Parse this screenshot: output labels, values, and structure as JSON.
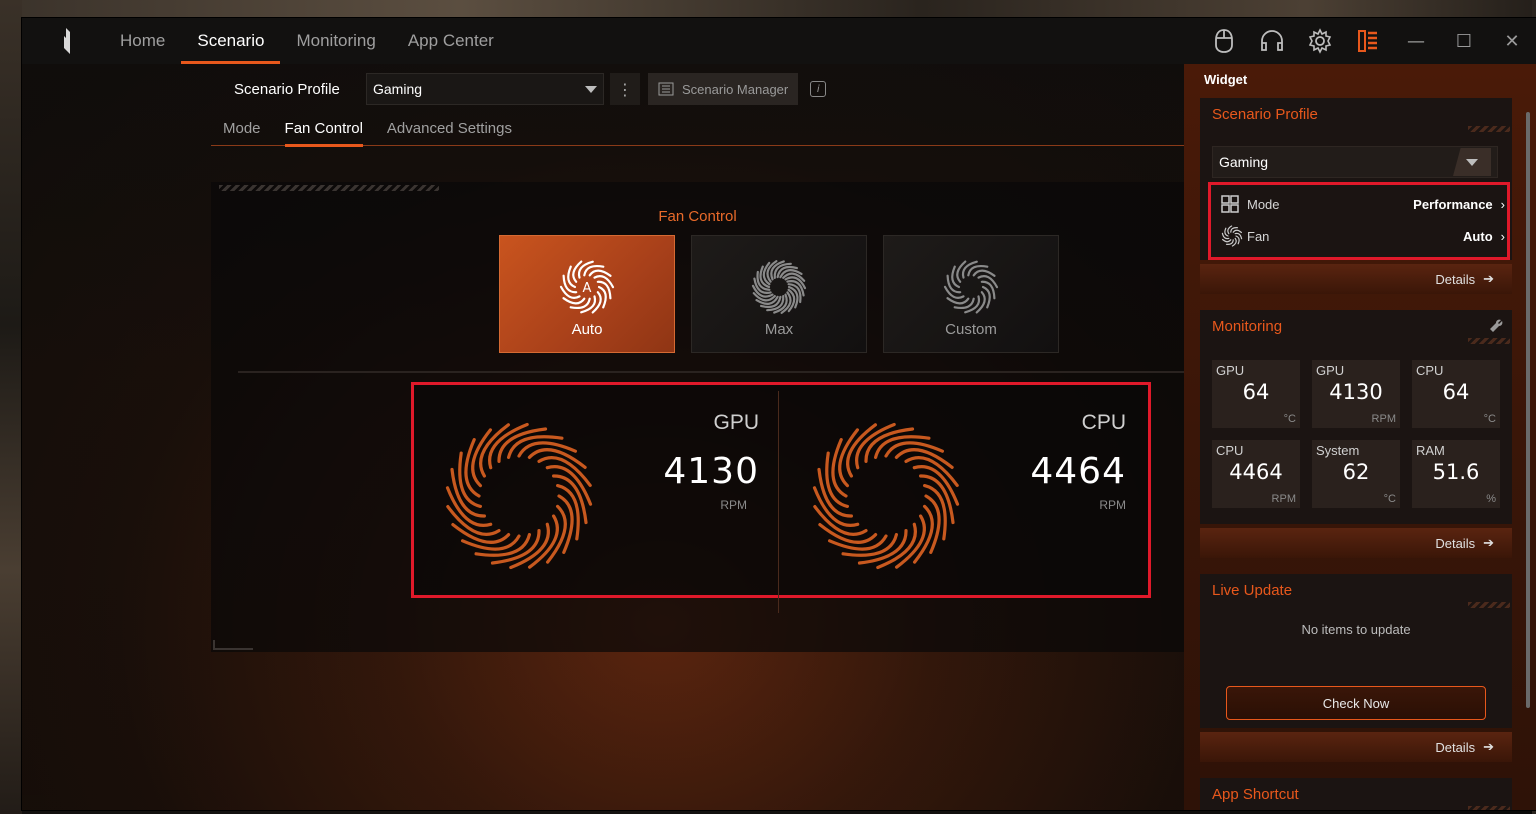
{
  "nav": {
    "items": [
      "Home",
      "Scenario",
      "Monitoring",
      "App Center"
    ],
    "active": "Scenario"
  },
  "profile": {
    "label": "Scenario Profile",
    "selected": "Gaming",
    "manager_label": "Scenario Manager"
  },
  "subtabs": {
    "items": [
      "Mode",
      "Fan Control",
      "Advanced Settings"
    ],
    "active": "Fan Control"
  },
  "fan_control": {
    "title": "Fan Control",
    "modes": [
      "Auto",
      "Max",
      "Custom"
    ],
    "active_mode": "Auto"
  },
  "rpm": {
    "gpu": {
      "name": "GPU",
      "value": "4130",
      "unit": "RPM"
    },
    "cpu": {
      "name": "CPU",
      "value": "4464",
      "unit": "RPM"
    }
  },
  "widget": {
    "title": "Widget",
    "scenario": {
      "title": "Scenario Profile",
      "selected": "Gaming",
      "mode_label": "Mode",
      "mode_value": "Performance",
      "fan_label": "Fan",
      "fan_value": "Auto",
      "details": "Details"
    },
    "monitoring": {
      "title": "Monitoring",
      "cells": [
        {
          "name": "GPU",
          "value": "64",
          "unit": "°C"
        },
        {
          "name": "GPU",
          "value": "4130",
          "unit": "RPM"
        },
        {
          "name": "CPU",
          "value": "64",
          "unit": "°C"
        },
        {
          "name": "CPU",
          "value": "4464",
          "unit": "RPM"
        },
        {
          "name": "System",
          "value": "62",
          "unit": "°C"
        },
        {
          "name": "RAM",
          "value": "51.6",
          "unit": "%"
        }
      ],
      "details": "Details"
    },
    "live_update": {
      "title": "Live Update",
      "empty": "No items to update",
      "button": "Check Now",
      "details": "Details"
    },
    "app_shortcut": {
      "title": "App Shortcut"
    }
  },
  "colors": {
    "accent": "#e8581c",
    "highlight": "#e0192a"
  }
}
